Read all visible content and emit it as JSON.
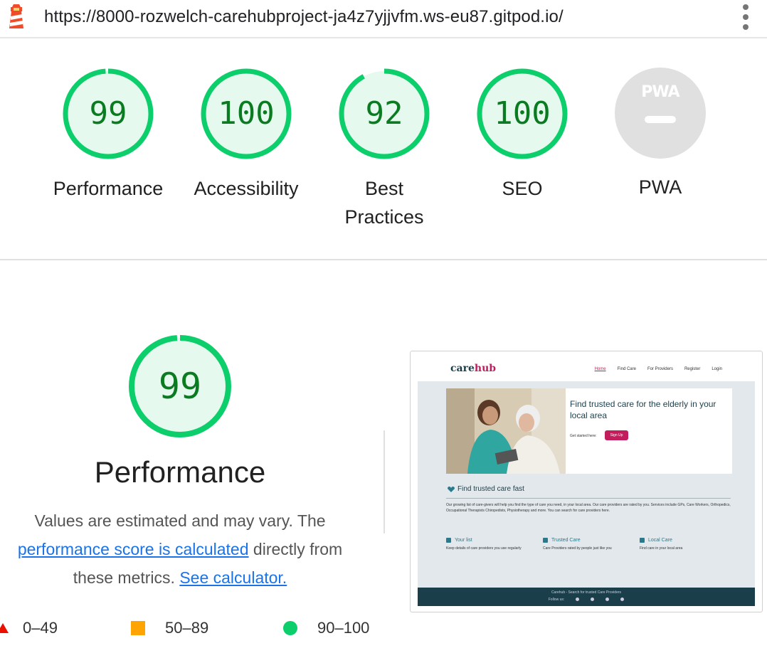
{
  "address_bar": {
    "url": "https://8000-rozwelch-carehubproject-ja4z7yjjvfm.ws-eu87.gitpod.io/"
  },
  "colors": {
    "pass_green": "#0cce6b",
    "pass_text": "#0b7b21",
    "average_orange": "#ffa400",
    "fail_red": "#eb0f00",
    "link_blue": "#1a73e8"
  },
  "gauges": [
    {
      "label": "Performance",
      "score": "99",
      "score_value": 99
    },
    {
      "label": "Accessibility",
      "score": "100",
      "score_value": 100
    },
    {
      "label": "Best Practices",
      "score": "92",
      "score_value": 92
    },
    {
      "label": "SEO",
      "score": "100",
      "score_value": 100
    },
    {
      "label": "PWA",
      "badge": "PWA"
    }
  ],
  "performance": {
    "score": "99",
    "score_value": 99,
    "title": "Performance",
    "desc_pre": "Values are estimated and may vary. The ",
    "desc_link1": "performance score is calculated",
    "desc_mid": " directly from these metrics. ",
    "desc_link2": "See calculator."
  },
  "legend": [
    {
      "range": "0–49",
      "shape": "triangle"
    },
    {
      "range": "50–89",
      "shape": "square"
    },
    {
      "range": "90–100",
      "shape": "circle"
    }
  ],
  "screenshot": {
    "logo_care": "care",
    "logo_hub": "hub",
    "nav": [
      "Home",
      "Find Care",
      "For Providers",
      "Register",
      "Login"
    ],
    "hero_title": "Find trusted care for the elderly in your local area",
    "hero_sub": "Get started here:",
    "hero_button": "Sign Up",
    "section_title": "Find trusted care fast",
    "section_text": "Our growing list of care-givers will help you find the type of care you need, in your local area. Our care providers are rated by you. Services include GPs, Care Workers, Orthopedics, Occupational Therapists Chiropedists, Physiotherapy and more. You can search for care providers here.",
    "features": [
      {
        "title": "Your list",
        "text": "Keep details of care providers you use regularly"
      },
      {
        "title": "Trusted Care",
        "text": "Care Providers rated by people just like you"
      },
      {
        "title": "Local Care",
        "text": "Find care in your local area"
      }
    ],
    "footer_title": "Carehub - Search for trusted Care Providers",
    "footer_follow": "Follow us:"
  }
}
